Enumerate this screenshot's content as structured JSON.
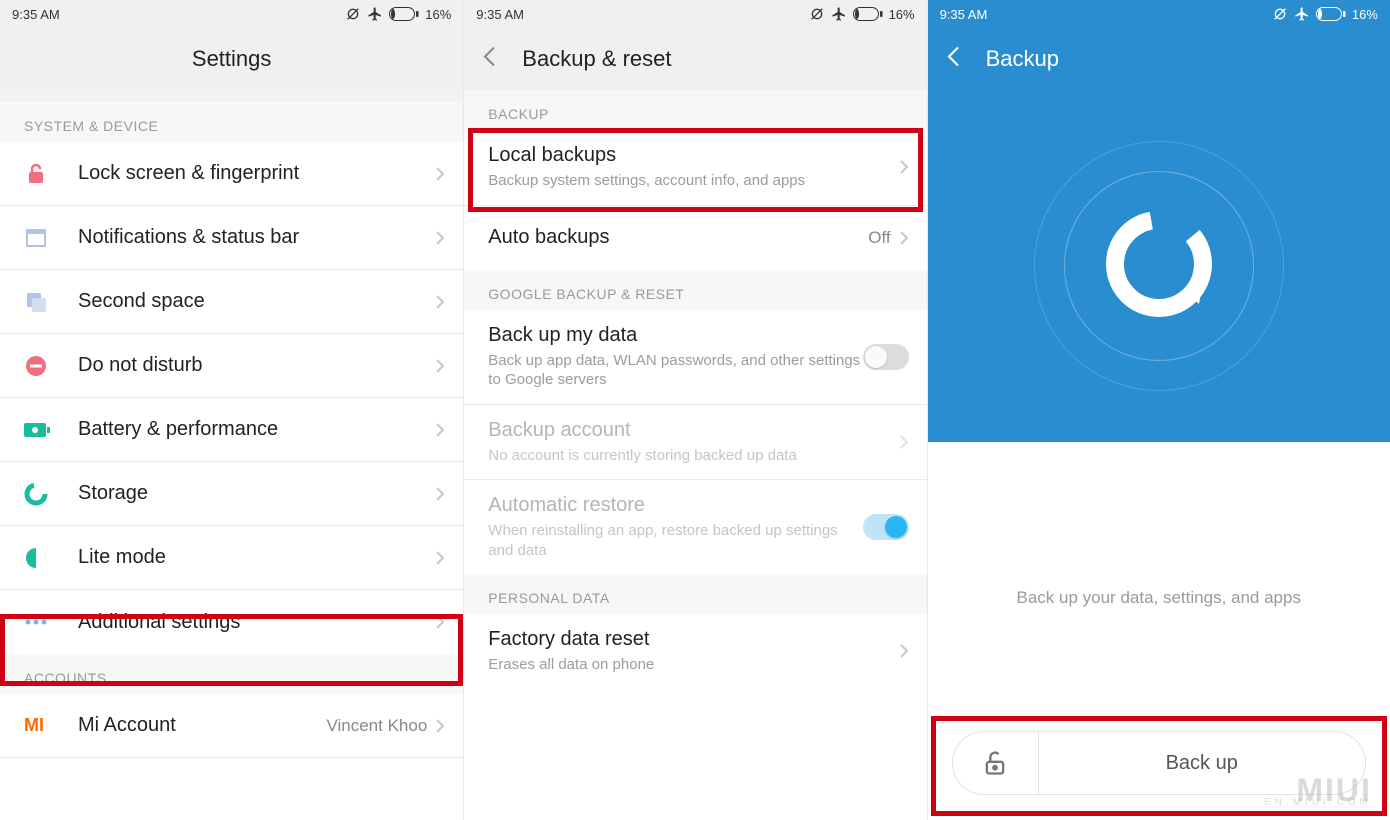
{
  "status": {
    "time": "9:35 AM",
    "battery_text": "16%"
  },
  "screen1": {
    "title": "Settings",
    "section_system": "SYSTEM & DEVICE",
    "section_accounts": "ACCOUNTS",
    "items": {
      "lock": "Lock screen & fingerprint",
      "notif": "Notifications & status bar",
      "second_space": "Second space",
      "dnd": "Do not disturb",
      "battery": "Battery & performance",
      "storage": "Storage",
      "lite": "Lite mode",
      "additional": "Additional settings",
      "mi_account": "Mi Account",
      "mi_account_value": "Vincent Khoo"
    }
  },
  "screen2": {
    "title": "Backup & reset",
    "section_backup": "BACKUP",
    "section_google": "GOOGLE BACKUP & RESET",
    "section_personal": "PERSONAL DATA",
    "local_backups": "Local backups",
    "local_backups_sub": "Backup system settings, account info, and apps",
    "auto_backups": "Auto backups",
    "auto_backups_value": "Off",
    "back_up_my_data": "Back up my data",
    "back_up_my_data_sub": "Back up app data, WLAN passwords, and other settings to Google servers",
    "backup_account": "Backup account",
    "backup_account_sub": "No account is currently storing backed up data",
    "automatic_restore": "Automatic restore",
    "automatic_restore_sub": "When reinstalling an app, restore backed up settings and data",
    "factory_reset": "Factory data reset",
    "factory_reset_sub": "Erases all data on phone"
  },
  "screen3": {
    "title": "Backup",
    "description": "Back up your data, settings, and apps",
    "button_label": "Back up",
    "watermark": "MIUI",
    "watermark_sub": "EN.MIUI.COM"
  }
}
